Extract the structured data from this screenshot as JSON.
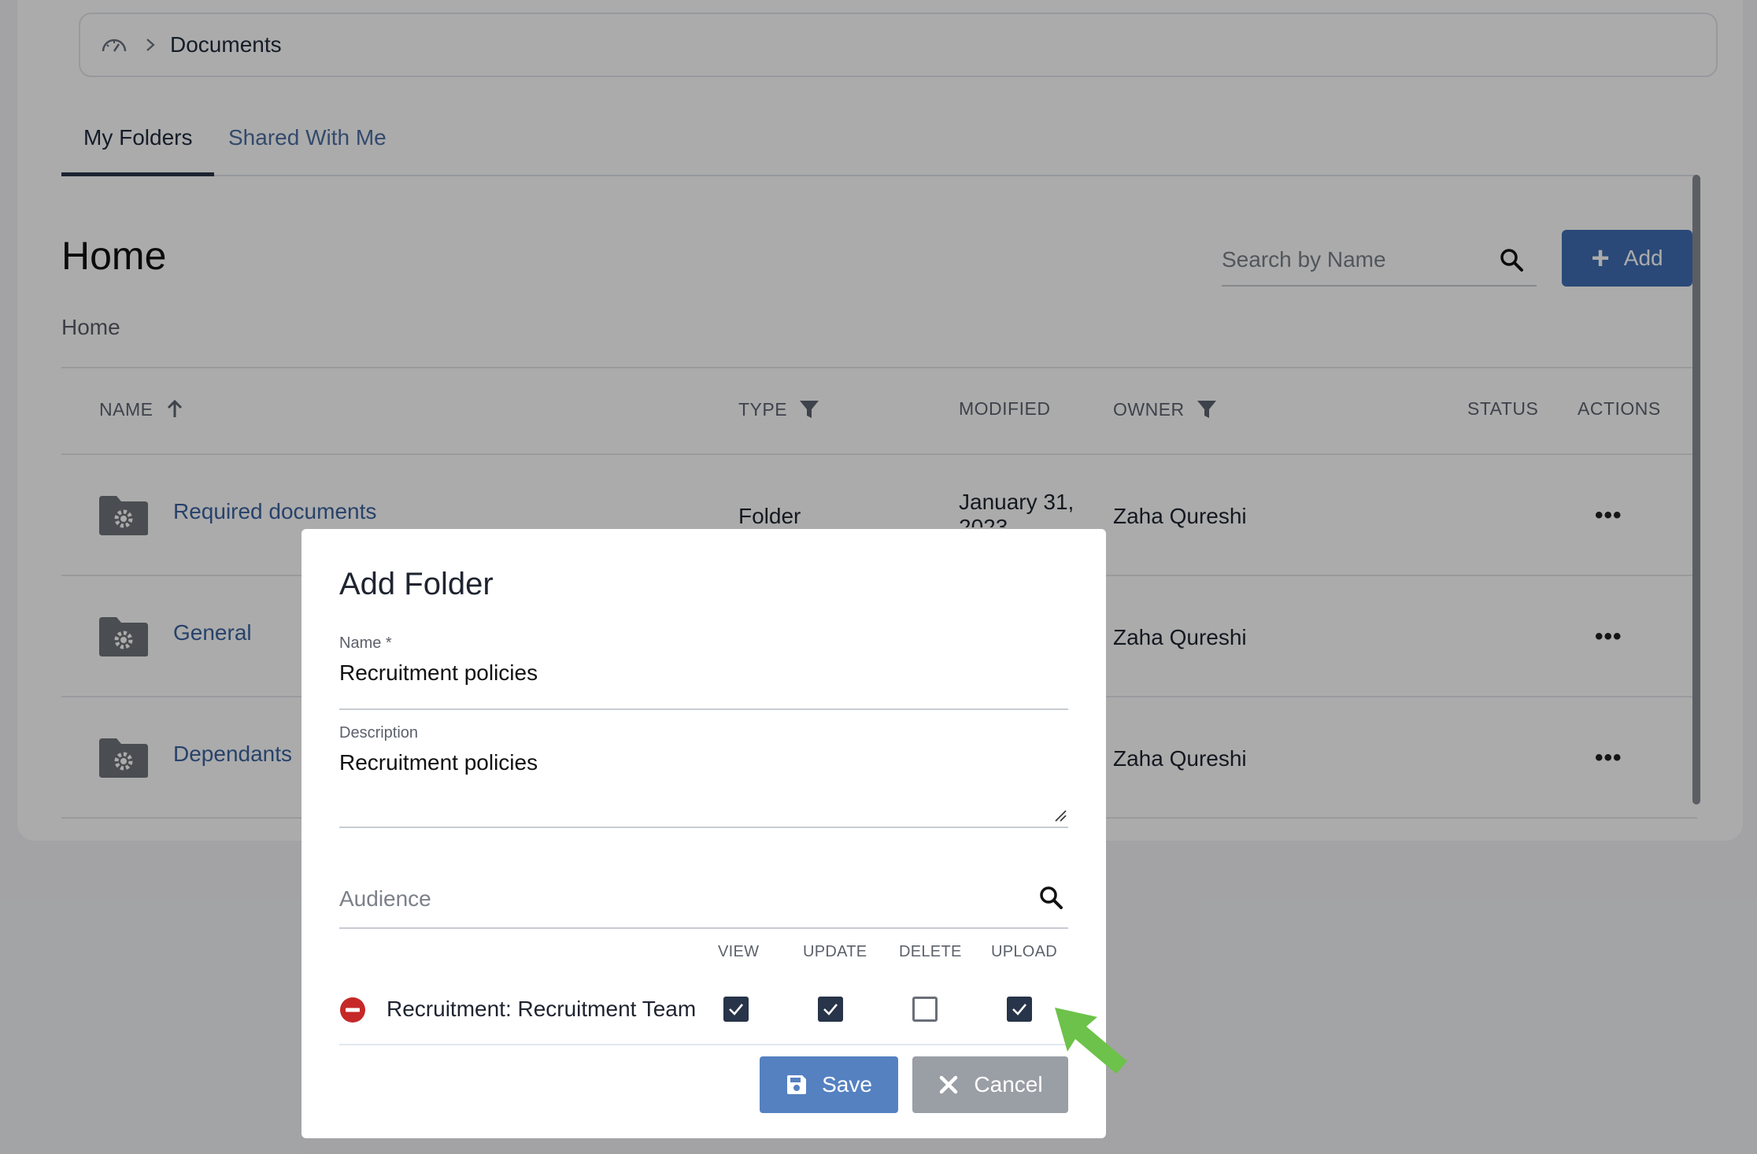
{
  "breadcrumb": {
    "label": "Documents"
  },
  "tabs": [
    {
      "label": "My Folders",
      "active": true
    },
    {
      "label": "Shared With Me",
      "active": false
    }
  ],
  "header": {
    "title": "Home",
    "path": "Home",
    "search_placeholder": "Search by Name",
    "add_label": "Add"
  },
  "table": {
    "columns": [
      "NAME",
      "TYPE",
      "MODIFIED",
      "OWNER",
      "STATUS",
      "ACTIONS"
    ],
    "rows": [
      {
        "name": "Required documents",
        "type": "Folder",
        "modified": "January 31, 2023",
        "owner": "Zaha Qureshi",
        "actions": "•••"
      },
      {
        "name": "General",
        "type": "",
        "modified": "",
        "owner": "Zaha Qureshi",
        "actions": "•••"
      },
      {
        "name": "Dependants",
        "type": "",
        "modified": "",
        "owner": "Zaha Qureshi",
        "actions": "•••"
      }
    ]
  },
  "modal": {
    "title": "Add Folder",
    "name_label": "Name *",
    "name_value": "Recruitment policies",
    "description_label": "Description",
    "description_value": "Recruitment policies",
    "audience_placeholder": "Audience",
    "permission_headers": [
      "VIEW",
      "UPDATE",
      "DELETE",
      "UPLOAD"
    ],
    "audience_entry": {
      "name": "Recruitment: Recruitment Team",
      "view": true,
      "update": true,
      "delete": false,
      "upload": true
    },
    "save_label": "Save",
    "cancel_label": "Cancel"
  },
  "colors": {
    "primary": "#3f6db3",
    "link": "#3b63a0",
    "checkbox": "#273449",
    "remove": "#c62828",
    "arrow": "#6cc24a"
  }
}
